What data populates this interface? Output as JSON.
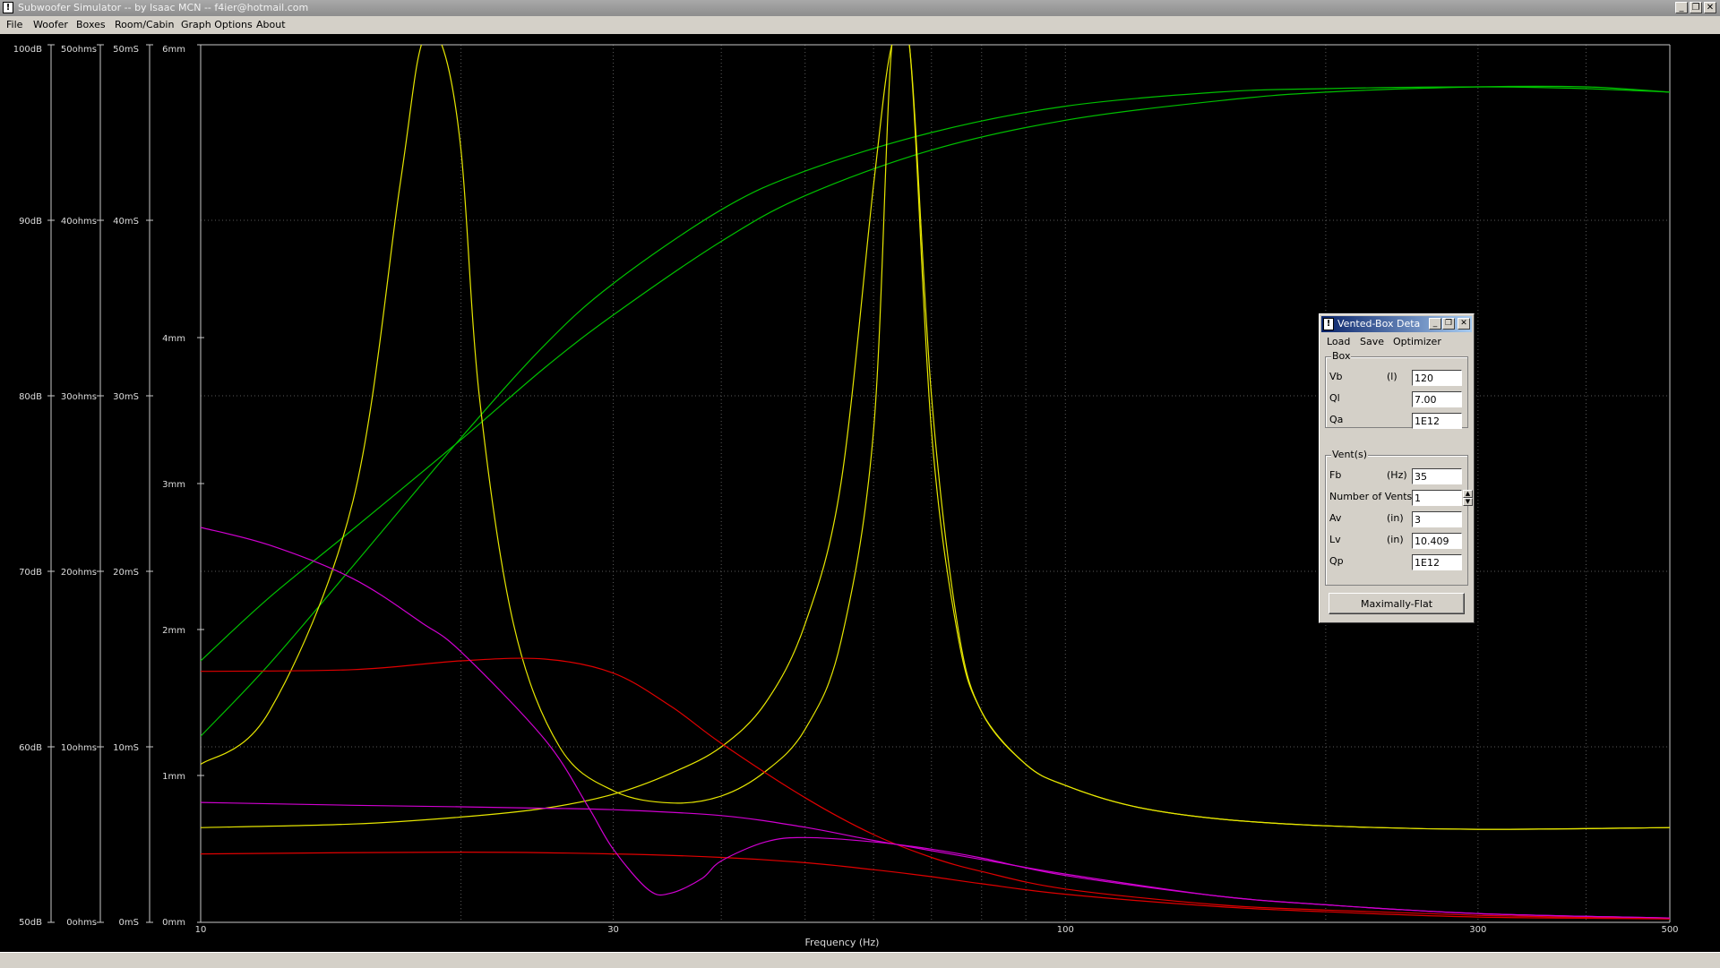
{
  "window": {
    "title": "Subwoofer Simulator -- by Isaac MCN -- f4ier@hotmail.com",
    "icon": "app-icon",
    "controls": {
      "minimize": "_",
      "restore": "❐",
      "close": "✕"
    }
  },
  "menu": [
    "File",
    "Woofer",
    "Boxes",
    "Room/Cabin",
    "Graph Options",
    "About"
  ],
  "graph": {
    "x_axis_title": "Frequency (Hz)",
    "x_tick_labels": [
      "10",
      "30",
      "100",
      "300",
      "500"
    ],
    "db_labels": [
      "100dB",
      "90dB",
      "80dB",
      "70dB",
      "60dB",
      "50dB"
    ],
    "ohm_labels": [
      "50ohms",
      "40ohms",
      "30ohms",
      "20ohms",
      "10ohms",
      "0ohms"
    ],
    "ms_labels": [
      "50mS",
      "40mS",
      "30mS",
      "20mS",
      "10mS",
      "0mS"
    ],
    "mm_labels": [
      "6mm",
      "4mm",
      "3mm",
      "2mm",
      "1mm",
      "0mm"
    ],
    "colors": {
      "spl": "#00c000",
      "impedance": "#e6e600",
      "group_delay": "#e00000",
      "excursion": "#d000d0",
      "grid": "#5a5a5a",
      "axis": "#c8c8c8"
    }
  },
  "chart_data": {
    "type": "line",
    "xlabel": "Frequency (Hz)",
    "x_scale": "log",
    "xlim": [
      10,
      500
    ],
    "y_axes": [
      {
        "unit": "dB",
        "range": [
          50,
          100
        ]
      },
      {
        "unit": "ohms",
        "range": [
          0,
          50
        ]
      },
      {
        "unit": "mS",
        "range": [
          0,
          50
        ]
      },
      {
        "unit": "mm",
        "range": [
          0,
          6
        ]
      }
    ],
    "series": [
      {
        "color": "#00c000",
        "axis": "dB",
        "x": [
          10,
          12,
          15,
          20,
          25,
          30,
          40,
          50,
          70,
          100,
          150,
          200,
          300,
          400,
          500
        ],
        "y": [
          64.9,
          68.5,
          72.4,
          77.5,
          81.6,
          84.6,
          88.8,
          91.4,
          94.0,
          95.7,
          96.8,
          97.3,
          97.6,
          97.6,
          97.3
        ]
      },
      {
        "color": "#00c000",
        "axis": "dB",
        "x": [
          10,
          12,
          15,
          20,
          25,
          30,
          40,
          50,
          70,
          100,
          150,
          200,
          300,
          400,
          500
        ],
        "y": [
          60.6,
          64.7,
          70.3,
          77.6,
          82.9,
          86.4,
          90.6,
          92.8,
          95.0,
          96.5,
          97.3,
          97.5,
          97.6,
          97.5,
          97.3
        ]
      },
      {
        "color": "#e6e600",
        "axis": "ohms",
        "x": [
          10,
          12,
          15,
          17,
          18,
          19,
          20,
          21,
          23,
          26,
          30,
          35,
          40,
          45,
          50,
          55,
          60,
          63,
          66,
          70,
          75,
          80,
          90,
          100,
          120,
          150,
          200,
          300,
          500
        ],
        "y": [
          9.0,
          12.0,
          24.0,
          42.0,
          50.0,
          50.0,
          44.0,
          30.0,
          17.0,
          10.0,
          7.5,
          6.8,
          7.2,
          8.6,
          11.0,
          16.0,
          28.0,
          50.0,
          50.0,
          28.0,
          16.5,
          12.0,
          9.0,
          7.8,
          6.6,
          5.9,
          5.5,
          5.3,
          5.4
        ]
      },
      {
        "color": "#e6e600",
        "axis": "ohms",
        "x": [
          10,
          15,
          20,
          25,
          30,
          35,
          40,
          45,
          50,
          55,
          60,
          63,
          66,
          70,
          75,
          80,
          90,
          100,
          120,
          150,
          200,
          300,
          500
        ],
        "y": [
          5.4,
          5.6,
          6.0,
          6.5,
          7.3,
          8.5,
          10.0,
          12.5,
          17.0,
          25.0,
          42.0,
          50.0,
          50.0,
          30.0,
          17.0,
          12.0,
          9.0,
          7.8,
          6.6,
          5.9,
          5.5,
          5.3,
          5.4
        ]
      },
      {
        "color": "#e00000",
        "axis": "mS",
        "x": [
          10,
          15,
          20,
          25,
          30,
          35,
          40,
          50,
          60,
          70,
          80,
          100,
          150,
          200,
          300,
          500
        ],
        "y": [
          14.3,
          14.4,
          14.9,
          15.0,
          14.2,
          12.3,
          10.2,
          7.1,
          5.0,
          3.7,
          2.9,
          1.9,
          1.0,
          0.7,
          0.4,
          0.2
        ]
      },
      {
        "color": "#e00000",
        "axis": "mS",
        "x": [
          10,
          20,
          30,
          40,
          50,
          60,
          70,
          80,
          100,
          150,
          200,
          300,
          500
        ],
        "y": [
          3.9,
          4.0,
          3.9,
          3.7,
          3.4,
          3.0,
          2.6,
          2.2,
          1.6,
          0.9,
          0.6,
          0.3,
          0.2
        ]
      },
      {
        "color": "#d000d0",
        "axis": "mm",
        "x": [
          10,
          12,
          15,
          18,
          20,
          25,
          28,
          30,
          33,
          35,
          38,
          40,
          45,
          50,
          60,
          70,
          80,
          100,
          150,
          200,
          300,
          500
        ],
        "y": [
          2.7,
          2.58,
          2.35,
          2.05,
          1.85,
          1.25,
          0.8,
          0.5,
          0.22,
          0.2,
          0.3,
          0.42,
          0.55,
          0.58,
          0.55,
          0.5,
          0.44,
          0.32,
          0.18,
          0.12,
          0.06,
          0.03
        ]
      },
      {
        "color": "#d000d0",
        "axis": "mm",
        "x": [
          10,
          15,
          20,
          25,
          30,
          40,
          50,
          60,
          70,
          80,
          100,
          150,
          200,
          300,
          500
        ],
        "y": [
          0.82,
          0.8,
          0.79,
          0.78,
          0.77,
          0.73,
          0.65,
          0.56,
          0.49,
          0.43,
          0.33,
          0.18,
          0.12,
          0.06,
          0.03
        ]
      }
    ]
  },
  "dialog": {
    "title": "Vented-Box Deta",
    "menu": [
      "Load",
      "Save",
      "Optimizer"
    ],
    "box_group": {
      "label": "Box",
      "fields": [
        {
          "label": "Vb",
          "unit": "(l)",
          "value": "120"
        },
        {
          "label": "Ql",
          "unit": "",
          "value": "7.00"
        },
        {
          "label": "Qa",
          "unit": "",
          "value": "1E12"
        }
      ]
    },
    "vent_group": {
      "label": "Vent(s)",
      "fields": [
        {
          "label": "Fb",
          "unit": "(Hz)",
          "value": "35"
        },
        {
          "label": "Number of Vents",
          "unit": "",
          "value": "1"
        },
        {
          "label": "Av",
          "unit": "(in)",
          "value": "3"
        },
        {
          "label": "Lv",
          "unit": "(in)",
          "value": "10.409"
        },
        {
          "label": "Qp",
          "unit": "",
          "value": "1E12"
        }
      ]
    },
    "button": "Maximally-Flat"
  }
}
